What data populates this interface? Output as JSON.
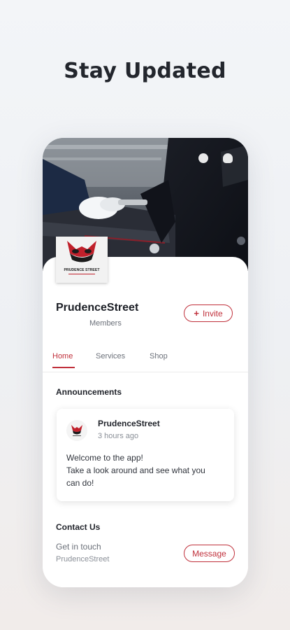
{
  "headline": "Stay Updated",
  "group": {
    "name": "PrudenceStreet",
    "members_label": "Members",
    "invite_label": "Invite",
    "logo_text": "PRUDENCE STREET"
  },
  "tabs": [
    {
      "label": "Home",
      "active": true
    },
    {
      "label": "Services",
      "active": false
    },
    {
      "label": "Shop",
      "active": false
    }
  ],
  "announcements": {
    "title": "Announcements",
    "post": {
      "author": "PrudenceStreet",
      "time": "3 hours ago",
      "lines": [
        "Welcome to the app!",
        "Take a look around and see what you",
        "can do!"
      ]
    }
  },
  "contact": {
    "title": "Contact Us",
    "subtitle": "Get in touch",
    "name": "PrudenceStreet",
    "message_label": "Message"
  },
  "colors": {
    "accent": "#c0303b",
    "background_top": "#f3f5f8",
    "card": "#ffffff"
  },
  "icons": [
    "chat-icon",
    "bell-icon",
    "plus-icon",
    "owl-logo-icon"
  ]
}
